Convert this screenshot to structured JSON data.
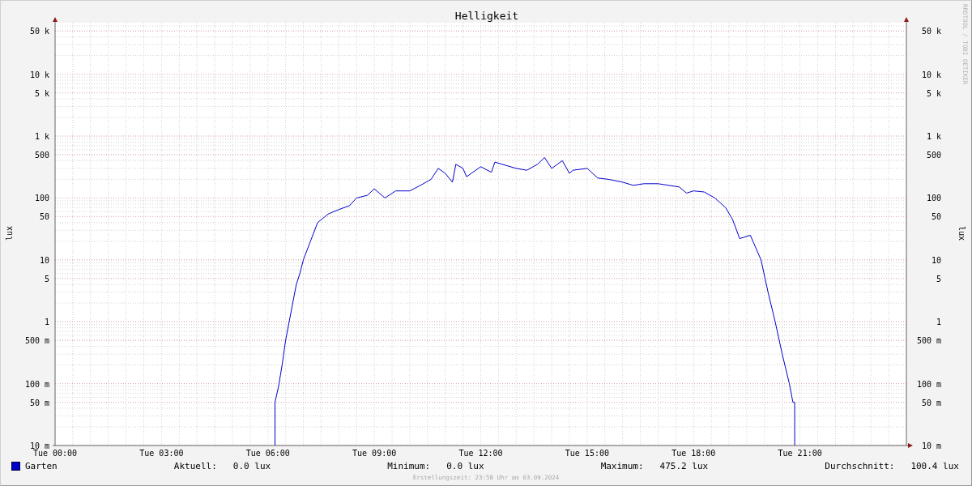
{
  "chart": {
    "title": "Helligkeit",
    "ylabel": "lux",
    "right_ylabel": "lux",
    "y_labels": [
      "50 k",
      "10 k",
      "5 k",
      "1 k",
      "500",
      "100",
      "50",
      "10",
      "5",
      "1",
      "500 m",
      "100 m",
      "50 m",
      "10 m"
    ],
    "right_y_labels": [
      "50 k",
      "10 k",
      "5 k",
      "1 k",
      "500",
      "100",
      "50",
      "10",
      "5",
      "1",
      "500 m",
      "100 m",
      "50 m",
      "10 m"
    ],
    "x_labels": [
      "Tue 00:00",
      "Tue 03:00",
      "Tue 06:00",
      "Tue 09:00",
      "Tue 12:00",
      "Tue 15:00",
      "Tue 18:00",
      "Tue 21:00"
    ]
  },
  "legend": {
    "series": {
      "name": "Garten",
      "color": "#0000cc"
    },
    "stats": [
      {
        "label": "Aktuell:",
        "value": "0.0 lux"
      },
      {
        "label": "Minimum:",
        "value": "0.0 lux"
      },
      {
        "label": "Maximum:",
        "value": "475.2 lux"
      },
      {
        "label": "Durchschnitt:",
        "value": "100.4 lux"
      }
    ]
  },
  "footer": "Erstellungszeit: 23:58 Uhr am 03.09.2024",
  "signature": "RRDTOOL / TOBI OETIKER"
}
